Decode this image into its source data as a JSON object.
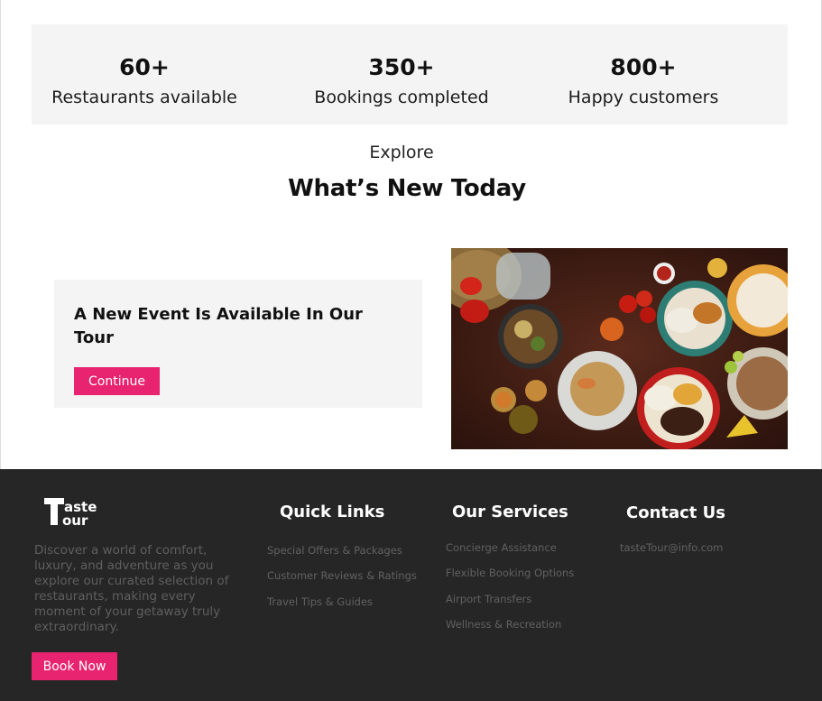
{
  "stats": [
    {
      "value": "60+",
      "label": "Restaurants available"
    },
    {
      "value": "350+",
      "label": "Bookings completed"
    },
    {
      "value": "800+",
      "label": "Happy customers"
    }
  ],
  "section": {
    "eyebrow": "Explore",
    "title": "What’s New Today"
  },
  "event": {
    "title": "A New Event Is Available In Our Tour",
    "button_label": "Continue"
  },
  "food_image": {
    "alt": "food-spread-photo"
  },
  "footer": {
    "logo_text": "Taste Tour",
    "about": "Discover a world of comfort, luxury, and adventure as you explore our curated selection of restaurants, making every moment of your getaway truly extraordinary.",
    "book_button": "Book Now",
    "quick_links": {
      "title": "Quick Links",
      "items": [
        "Special Offers & Packages",
        "Customer Reviews & Ratings",
        "Travel Tips & Guides"
      ]
    },
    "services": {
      "title": "Our Services",
      "items": [
        "Concierge Assistance",
        "Flexible Booking Options",
        "Airport Transfers",
        "Wellness & Recreation"
      ]
    },
    "contact": {
      "title": "Contact Us",
      "email": "tasteTour@info.com"
    }
  },
  "colors": {
    "accent": "#e8236f",
    "footer_bg": "#262626",
    "card_bg": "#f4f4f4"
  }
}
